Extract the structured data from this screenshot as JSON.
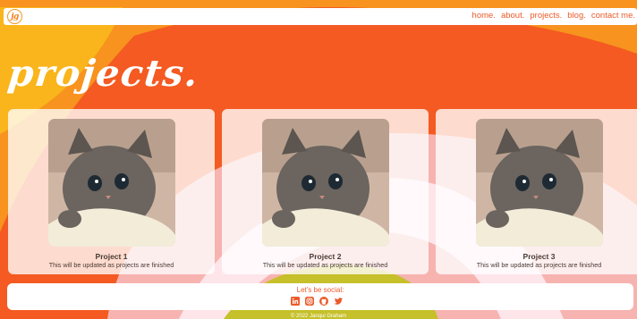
{
  "nav": {
    "logo_text": "jg",
    "links": [
      "home.",
      "about.",
      "projects.",
      "blog.",
      "contact me."
    ]
  },
  "main": {
    "title": "projects.",
    "projects": [
      {
        "title": "Project 1",
        "description": "This will be updated as projects are finished"
      },
      {
        "title": "Project 2",
        "description": "This will be updated as projects are finished"
      },
      {
        "title": "Project 3",
        "description": "This will be updated as projects are finished"
      }
    ]
  },
  "footer": {
    "social_label": "Let's be social:",
    "social_icons": [
      "linkedin-icon",
      "instagram-icon",
      "github-icon",
      "twitter-icon"
    ],
    "copyright": "© 2022 Janqui Graham"
  },
  "colors": {
    "accent": "#ec5a2a",
    "orange": "#f7931e",
    "red": "#f4541f",
    "pink": "#f7b3b0",
    "olive": "#c6c02a"
  }
}
